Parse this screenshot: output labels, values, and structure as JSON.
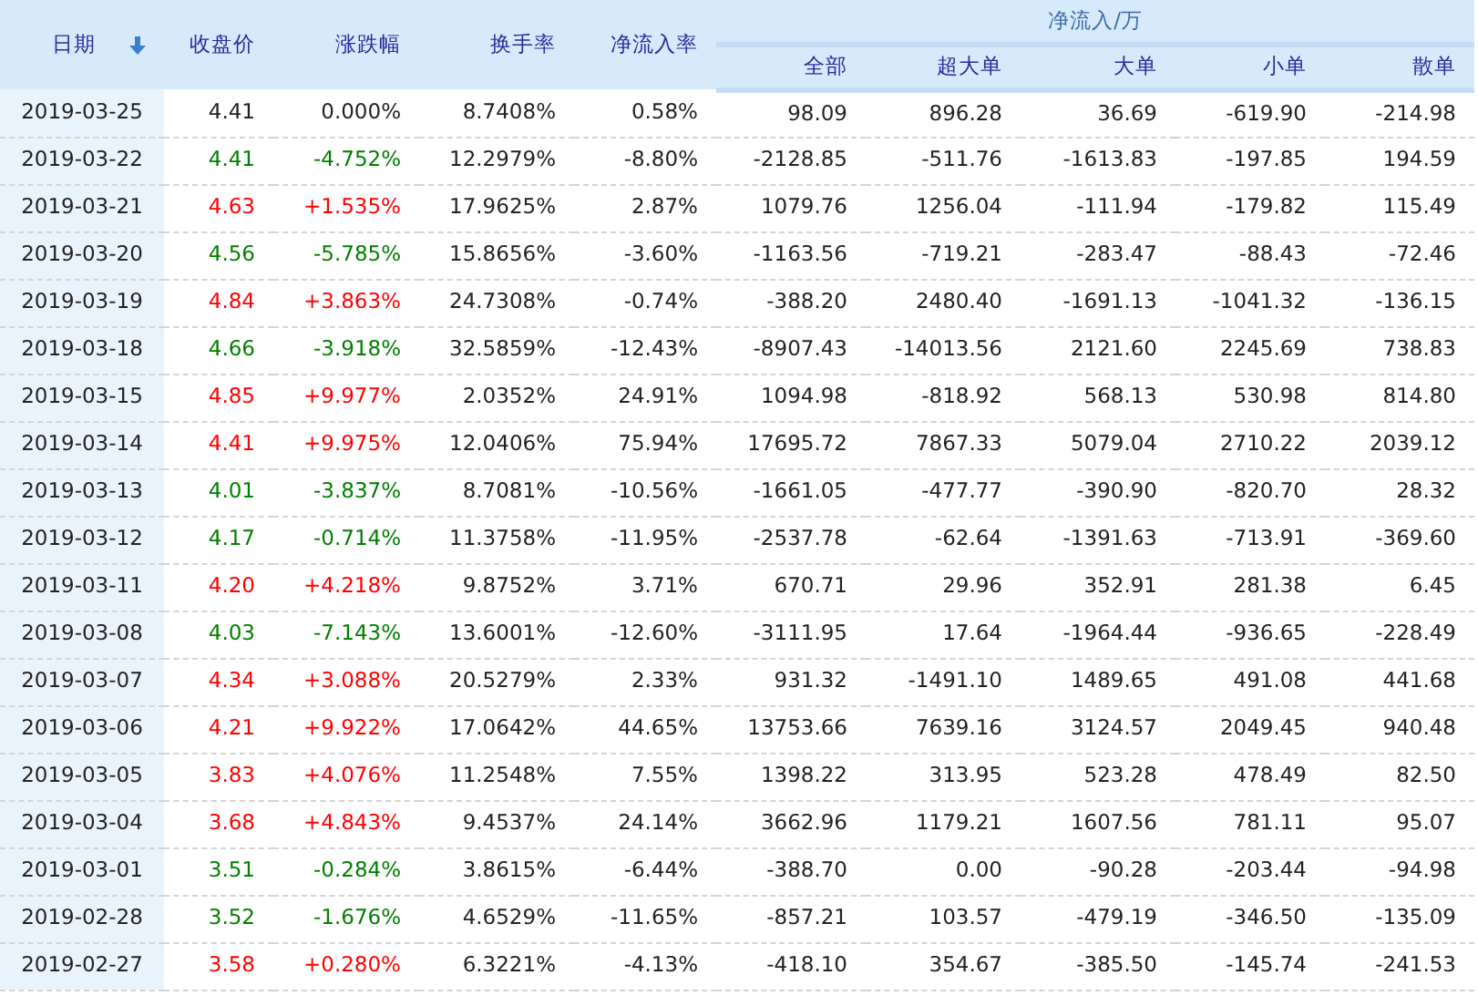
{
  "columns": [
    {
      "label": "日期",
      "sorted": true
    },
    {
      "label": "收盘价",
      "sorted": false
    },
    {
      "label": "涨跌幅",
      "sorted": false
    },
    {
      "label": "换手率",
      "sorted": false
    },
    {
      "label": "净流入率",
      "sorted": false
    }
  ],
  "group_header": "净流入/万",
  "sub_columns": [
    "全部",
    "超大单",
    "大单",
    "小单",
    "散单"
  ],
  "rows": [
    {
      "color": "#222222",
      "cells": [
        "2019-03-25",
        "4.41",
        "0.000%",
        "8.7408%",
        "0.58%",
        "98.09",
        "896.28",
        "36.69",
        "-619.90",
        "-214.98"
      ]
    },
    {
      "color": "#008000",
      "cells": [
        "2019-03-22",
        "4.41",
        "-4.752%",
        "12.2979%",
        "-8.80%",
        "-2128.85",
        "-511.76",
        "-1613.83",
        "-197.85",
        "194.59"
      ]
    },
    {
      "color": "#ff0000",
      "cells": [
        "2019-03-21",
        "4.63",
        "+1.535%",
        "17.9625%",
        "2.87%",
        "1079.76",
        "1256.04",
        "-111.94",
        "-179.82",
        "115.49"
      ]
    },
    {
      "color": "#008000",
      "cells": [
        "2019-03-20",
        "4.56",
        "-5.785%",
        "15.8656%",
        "-3.60%",
        "-1163.56",
        "-719.21",
        "-283.47",
        "-88.43",
        "-72.46"
      ]
    },
    {
      "color": "#ff0000",
      "cells": [
        "2019-03-19",
        "4.84",
        "+3.863%",
        "24.7308%",
        "-0.74%",
        "-388.20",
        "2480.40",
        "-1691.13",
        "-1041.32",
        "-136.15"
      ]
    },
    {
      "color": "#008000",
      "cells": [
        "2019-03-18",
        "4.66",
        "-3.918%",
        "32.5859%",
        "-12.43%",
        "-8907.43",
        "-14013.56",
        "2121.60",
        "2245.69",
        "738.83"
      ]
    },
    {
      "color": "#ff0000",
      "cells": [
        "2019-03-15",
        "4.85",
        "+9.977%",
        "2.0352%",
        "24.91%",
        "1094.98",
        "-818.92",
        "568.13",
        "530.98",
        "814.80"
      ]
    },
    {
      "color": "#ff0000",
      "cells": [
        "2019-03-14",
        "4.41",
        "+9.975%",
        "12.0406%",
        "75.94%",
        "17695.72",
        "7867.33",
        "5079.04",
        "2710.22",
        "2039.12"
      ]
    },
    {
      "color": "#008000",
      "cells": [
        "2019-03-13",
        "4.01",
        "-3.837%",
        "8.7081%",
        "-10.56%",
        "-1661.05",
        "-477.77",
        "-390.90",
        "-820.70",
        "28.32"
      ]
    },
    {
      "color": "#008000",
      "cells": [
        "2019-03-12",
        "4.17",
        "-0.714%",
        "11.3758%",
        "-11.95%",
        "-2537.78",
        "-62.64",
        "-1391.63",
        "-713.91",
        "-369.60"
      ]
    },
    {
      "color": "#ff0000",
      "cells": [
        "2019-03-11",
        "4.20",
        "+4.218%",
        "9.8752%",
        "3.71%",
        "670.71",
        "29.96",
        "352.91",
        "281.38",
        "6.45"
      ]
    },
    {
      "color": "#008000",
      "cells": [
        "2019-03-08",
        "4.03",
        "-7.143%",
        "13.6001%",
        "-12.60%",
        "-3111.95",
        "17.64",
        "-1964.44",
        "-936.65",
        "-228.49"
      ]
    },
    {
      "color": "#ff0000",
      "cells": [
        "2019-03-07",
        "4.34",
        "+3.088%",
        "20.5279%",
        "2.33%",
        "931.32",
        "-1491.10",
        "1489.65",
        "491.08",
        "441.68"
      ]
    },
    {
      "color": "#ff0000",
      "cells": [
        "2019-03-06",
        "4.21",
        "+9.922%",
        "17.0642%",
        "44.65%",
        "13753.66",
        "7639.16",
        "3124.57",
        "2049.45",
        "940.48"
      ]
    },
    {
      "color": "#ff0000",
      "cells": [
        "2019-03-05",
        "3.83",
        "+4.076%",
        "11.2548%",
        "7.55%",
        "1398.22",
        "313.95",
        "523.28",
        "478.49",
        "82.50"
      ]
    },
    {
      "color": "#ff0000",
      "cells": [
        "2019-03-04",
        "3.68",
        "+4.843%",
        "9.4537%",
        "24.14%",
        "3662.96",
        "1179.21",
        "1607.56",
        "781.11",
        "95.07"
      ]
    },
    {
      "color": "#008000",
      "cells": [
        "2019-03-01",
        "3.51",
        "-0.284%",
        "3.8615%",
        "-6.44%",
        "-388.70",
        "0.00",
        "-90.28",
        "-203.44",
        "-94.98"
      ]
    },
    {
      "color": "#008000",
      "cells": [
        "2019-02-28",
        "3.52",
        "-1.676%",
        "4.6529%",
        "-11.65%",
        "-857.21",
        "103.57",
        "-479.19",
        "-346.50",
        "-135.09"
      ]
    },
    {
      "color": "#ff0000",
      "cells": [
        "2019-02-27",
        "3.58",
        "+0.280%",
        "6.3221%",
        "-4.13%",
        "-418.10",
        "354.67",
        "-385.50",
        "-145.74",
        "-241.53"
      ]
    }
  ]
}
